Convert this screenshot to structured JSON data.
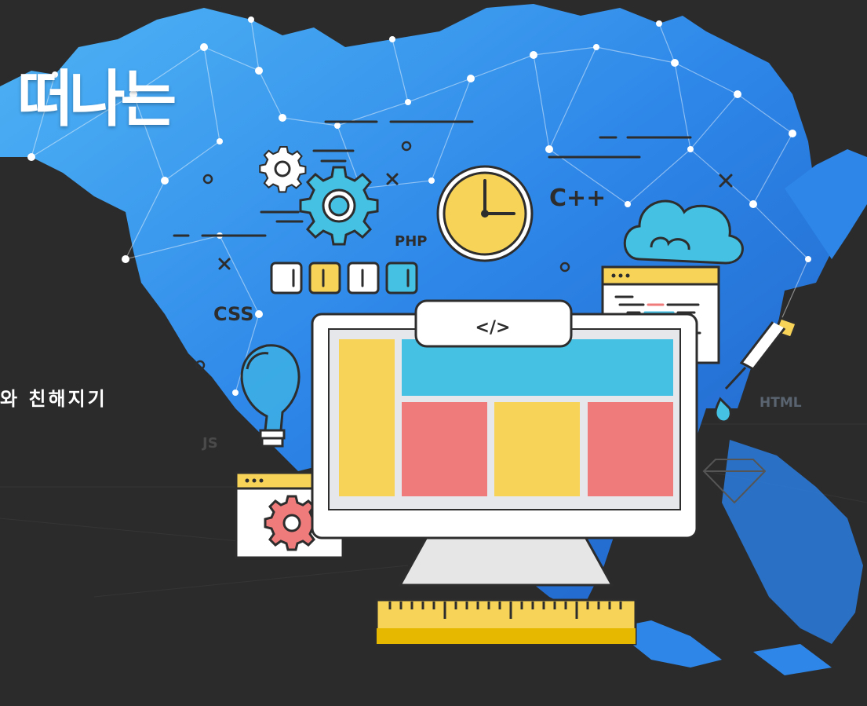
{
  "banner": {
    "headline": "떠나는",
    "subline": "와 친해지기"
  },
  "illustration": {
    "tech_labels": {
      "cpp": "C++",
      "php": "PHP",
      "css": "CSS",
      "js": "JS",
      "html": "HTML",
      "code_tag": "</>"
    },
    "icons": [
      "gear-icon",
      "clock-icon",
      "cloud-icon",
      "lightbulb-icon",
      "monitor-icon",
      "ruler-icon",
      "eyedropper-icon",
      "code-window-icon",
      "settings-window-icon",
      "diamond-icon"
    ]
  },
  "colors": {
    "background": "#2b2b2b",
    "map_blue": "#2f86e6",
    "yellow": "#f7d358",
    "cyan": "#45c1e3",
    "red": "#f07b7b",
    "dark_outline": "#2d2d2d"
  }
}
